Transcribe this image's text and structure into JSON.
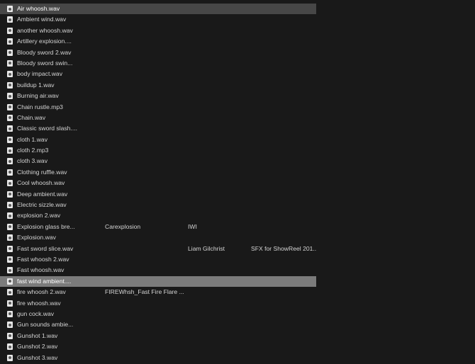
{
  "files": [
    {
      "name": "Air whoosh.wav",
      "album": "",
      "artist": "",
      "title": "",
      "state": "selected"
    },
    {
      "name": "Ambient wind.wav",
      "album": "",
      "artist": "",
      "title": "",
      "state": ""
    },
    {
      "name": "another whoosh.wav",
      "album": "",
      "artist": "",
      "title": "",
      "state": ""
    },
    {
      "name": "Artillery explosion....",
      "album": "",
      "artist": "",
      "title": "",
      "state": ""
    },
    {
      "name": "Bloody sword 2.wav",
      "album": "",
      "artist": "",
      "title": "",
      "state": ""
    },
    {
      "name": "Bloody sword swin...",
      "album": "",
      "artist": "",
      "title": "",
      "state": ""
    },
    {
      "name": "body impact.wav",
      "album": "",
      "artist": "",
      "title": "",
      "state": ""
    },
    {
      "name": "buildup 1.wav",
      "album": "",
      "artist": "",
      "title": "",
      "state": ""
    },
    {
      "name": "Burning air.wav",
      "album": "",
      "artist": "",
      "title": "",
      "state": ""
    },
    {
      "name": "Chain rustle.mp3",
      "album": "",
      "artist": "",
      "title": "",
      "state": ""
    },
    {
      "name": "Chain.wav",
      "album": "",
      "artist": "",
      "title": "",
      "state": ""
    },
    {
      "name": "Classic sword slash....",
      "album": "",
      "artist": "",
      "title": "",
      "state": ""
    },
    {
      "name": "cloth 1.wav",
      "album": "",
      "artist": "",
      "title": "",
      "state": ""
    },
    {
      "name": "cloth 2.mp3",
      "album": "",
      "artist": "",
      "title": "",
      "state": ""
    },
    {
      "name": "cloth 3.wav",
      "album": "",
      "artist": "",
      "title": "",
      "state": ""
    },
    {
      "name": "Clothing ruffle.wav",
      "album": "",
      "artist": "",
      "title": "",
      "state": ""
    },
    {
      "name": "Cool whoosh.wav",
      "album": "",
      "artist": "",
      "title": "",
      "state": ""
    },
    {
      "name": "Deep ambient.wav",
      "album": "",
      "artist": "",
      "title": "",
      "state": ""
    },
    {
      "name": "Electric sizzle.wav",
      "album": "",
      "artist": "",
      "title": "",
      "state": ""
    },
    {
      "name": "explosion 2.wav",
      "album": "",
      "artist": "",
      "title": "",
      "state": ""
    },
    {
      "name": "Explosion glass bre...",
      "album": "Carexplosion",
      "artist": "IWI",
      "title": "",
      "state": ""
    },
    {
      "name": "Explosion.wav",
      "album": "",
      "artist": "",
      "title": "",
      "state": ""
    },
    {
      "name": "Fast sword slice.wav",
      "album": "",
      "artist": "Liam Gilchrist",
      "title": "SFX for ShowReel 201...",
      "state": ""
    },
    {
      "name": "Fast whoosh 2.wav",
      "album": "",
      "artist": "",
      "title": "",
      "state": ""
    },
    {
      "name": "Fast whoosh.wav",
      "album": "",
      "artist": "",
      "title": "",
      "state": ""
    },
    {
      "name": "fast wind ambient....",
      "album": "",
      "artist": "",
      "title": "",
      "state": "selected-alt"
    },
    {
      "name": "fire whoosh 2.wav",
      "album": "FIREWhsh_Fast Fire Flare ...",
      "artist": "",
      "title": "",
      "state": ""
    },
    {
      "name": "fire whoosh.wav",
      "album": "",
      "artist": "",
      "title": "",
      "state": ""
    },
    {
      "name": "gun cock.wav",
      "album": "",
      "artist": "",
      "title": "",
      "state": ""
    },
    {
      "name": "Gun sounds ambie...",
      "album": "",
      "artist": "",
      "title": "",
      "state": ""
    },
    {
      "name": "Gunshot 1.wav",
      "album": "",
      "artist": "",
      "title": "",
      "state": ""
    },
    {
      "name": "Gunshot 2.wav",
      "album": "",
      "artist": "",
      "title": "",
      "state": ""
    },
    {
      "name": "Gunshot 3.wav",
      "album": "",
      "artist": "",
      "title": "",
      "state": ""
    }
  ],
  "icons": {
    "file": "audio-file-icon"
  }
}
